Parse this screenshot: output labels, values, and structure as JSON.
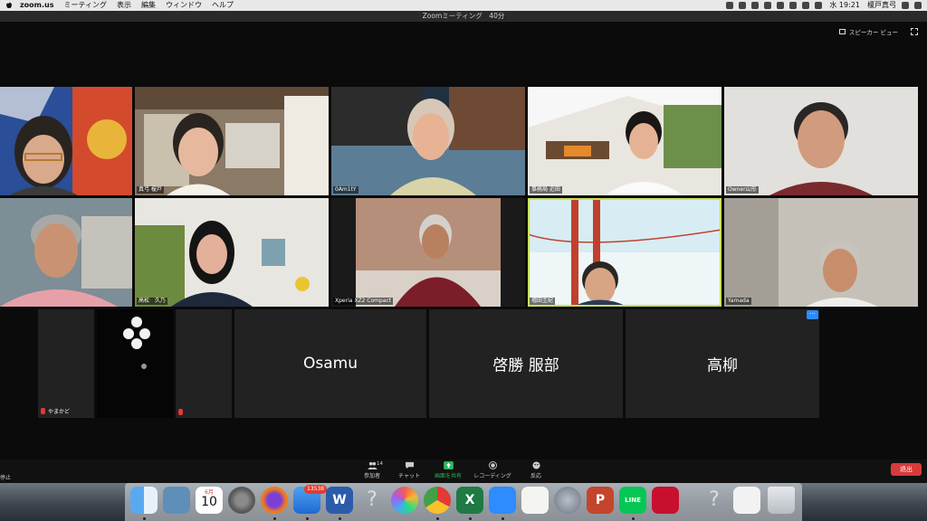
{
  "menubar": {
    "app_name": "zoom.us",
    "items": [
      "ミーティング",
      "表示",
      "編集",
      "ウィンドウ",
      "ヘルプ"
    ],
    "clock": "水 19:21",
    "user": "榎戸真弓"
  },
  "window": {
    "title": "Zoomミーティング　40分"
  },
  "view": {
    "speaker_view_label": "スピーカー ビュー"
  },
  "participants": [
    {
      "name": ""
    },
    {
      "name": "真弓 榎戸"
    },
    {
      "name": "0Am1tY"
    },
    {
      "name": "事務局 近田"
    },
    {
      "name": "Owner山形"
    },
    {
      "name": ""
    },
    {
      "name": "高松　久乃"
    },
    {
      "name": "Xperia XZ2 Compact"
    },
    {
      "name": "増田圭紀"
    },
    {
      "name": "Yamada"
    }
  ],
  "no_video": [
    {
      "name": "やまかど"
    },
    {
      "name": ""
    },
    {
      "name": "Osamu"
    },
    {
      "name": "啓勝 服部"
    },
    {
      "name": "高柳"
    }
  ],
  "toolbar": {
    "stop_label": "停止",
    "participants_label": "参加者",
    "participants_count": "14",
    "chat_label": "チャット",
    "share_label": "画面を共有",
    "record_label": "レコーディング",
    "reactions_label": "反応",
    "leave_label": "退出"
  },
  "dock": {
    "icons": [
      "finder-icon",
      "preview-icon",
      "calendar-icon",
      "system-preferences-icon",
      "firefox-icon",
      "mail-icon",
      "word-icon",
      "unknown-app-icon",
      "photos-icon",
      "chrome-icon",
      "excel-icon",
      "zoom-icon",
      "textedit-icon",
      "launchpad-icon",
      "powerpoint-icon",
      "line-icon",
      "acrobat-icon",
      "unknown-app-icon",
      "document-icon",
      "trash-icon"
    ],
    "calendar_date": "10",
    "calendar_month": "6月",
    "mail_badge": "13538",
    "line_label": "LINE"
  },
  "colors": {
    "active_speaker": "#c8e05a",
    "leave": "#d83a3a",
    "share": "#2db55d",
    "muted": "#e13838"
  }
}
